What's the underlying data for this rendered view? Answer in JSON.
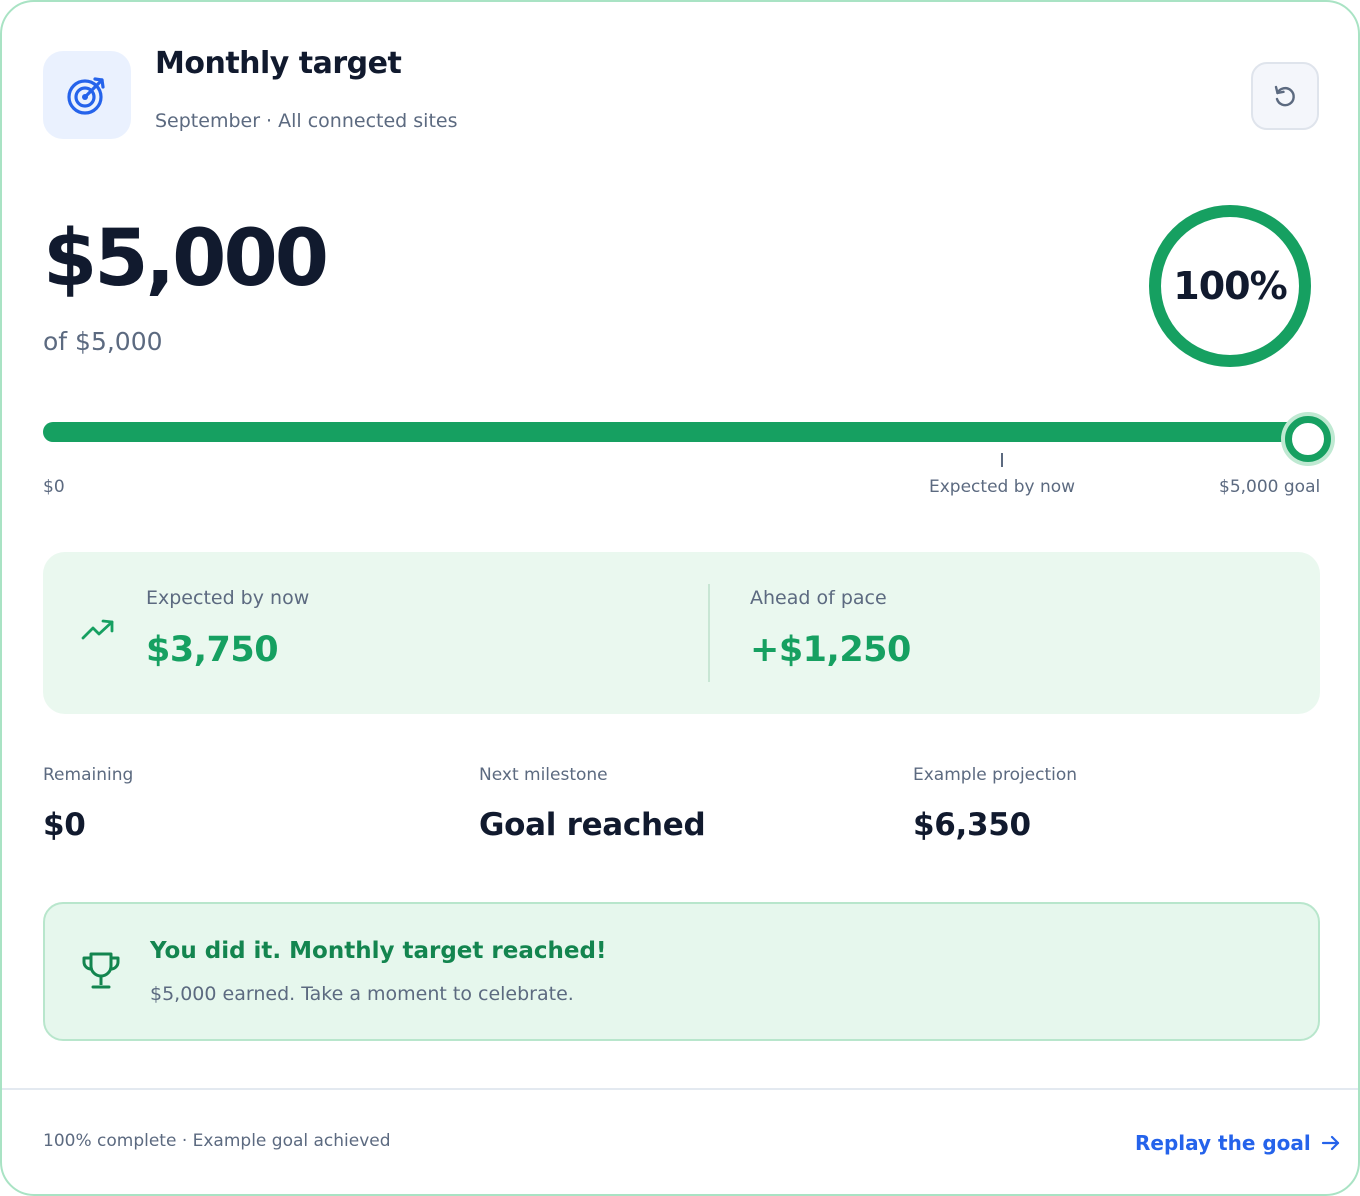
{
  "header": {
    "title": "Monthly target",
    "subtitle": "September · All connected sites",
    "icon": "target-icon",
    "reset_icon": "reset-icon"
  },
  "summary": {
    "amount": "$5,000",
    "of_goal": "of $5,000",
    "percent_label": "100%",
    "percent": 100
  },
  "progress": {
    "fraction": 1.0,
    "expected_fraction": 0.75,
    "start_label": "$0",
    "expected_label": "Expected by now",
    "goal_label": "$5,000 goal"
  },
  "pace": {
    "icon": "trending-up-icon",
    "expected_label": "Expected by now",
    "expected_value": "$3,750",
    "ahead_label": "Ahead of pace",
    "ahead_value": "+$1,250"
  },
  "stats": [
    {
      "label": "Remaining",
      "value": "$0"
    },
    {
      "label": "Next milestone",
      "value": "Goal reached"
    },
    {
      "label": "Example projection",
      "value": "$6,350"
    }
  ],
  "celebration": {
    "icon": "trophy-icon",
    "title": "You did it. Monthly target reached!",
    "subtitle": "$5,000 earned. Take a moment to celebrate."
  },
  "footer": {
    "status": "100% complete · Example goal achieved",
    "replay_label": "Replay the goal",
    "replay_icon": "arrow-right-icon"
  },
  "colors": {
    "accent_green": "#16a061",
    "accent_blue": "#2563eb",
    "text_dark": "#111a2e",
    "text_muted": "#5c6a80"
  }
}
